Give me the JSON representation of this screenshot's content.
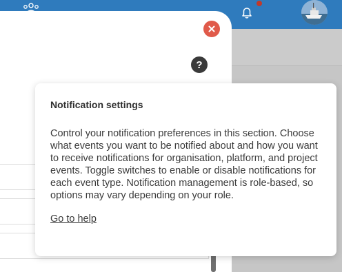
{
  "header": {
    "team_icon": "team-icon",
    "bell_icon": "bell-icon",
    "notification_dot_color": "#c0392b",
    "avatar": "user-avatar"
  },
  "modal": {
    "close_icon": "close-icon",
    "help_label": "?",
    "help_icon": "help-icon"
  },
  "popover": {
    "title": "Notification settings",
    "body": "Control your notification preferences in this section. Choose what events you want to be notified about and how you want to receive notifications for organisation, platform, and project events. Toggle switches to enable or disable notifications for each event type. Notification management is role-based, so options may vary depending on your role.",
    "link": "Go to help"
  },
  "colors": {
    "topbar": "#2f7bbd",
    "close_button": "#e05a4a",
    "help_button": "#3a3a3a"
  }
}
